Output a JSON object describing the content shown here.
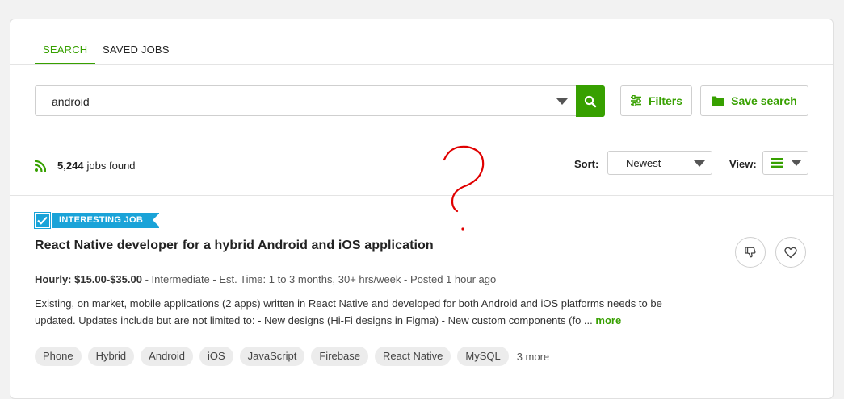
{
  "tabs": [
    {
      "label": "SEARCH",
      "active": true
    },
    {
      "label": "SAVED JOBS",
      "active": false
    }
  ],
  "search": {
    "value": "android",
    "placeholder": ""
  },
  "buttons": {
    "filters": "Filters",
    "save_search": "Save search"
  },
  "results": {
    "count": "5,244",
    "label": "jobs found"
  },
  "sort": {
    "label": "Sort:",
    "value": "Newest"
  },
  "view": {
    "label": "View:"
  },
  "job": {
    "badge": "INTERESTING JOB",
    "title": "React Native developer for a hybrid Android and iOS application",
    "rate": "Hourly: $15.00-$35.00",
    "meta_rest": " - Intermediate - Est. Time: 1 to 3 months, 30+ hrs/week - Posted 1 hour ago",
    "description": "Existing, on market, mobile applications (2 apps) written in React Native and developed for both Android and iOS platforms needs to be updated. Updates include but are not limited to: - New designs (Hi-Fi designs in Figma) - New custom components (fo ...",
    "more": "more",
    "tags": [
      "Phone",
      "Hybrid",
      "Android",
      "iOS",
      "JavaScript",
      "Firebase",
      "React Native",
      "MySQL"
    ],
    "more_tags": "3 more"
  },
  "colors": {
    "accent": "#37a000",
    "badge": "#1aa3d8",
    "annotation": "#e00000"
  },
  "icons": [
    "search-icon",
    "filters-icon",
    "folder-icon",
    "rss-icon",
    "list-view-icon",
    "thumbs-down-icon",
    "heart-icon",
    "check-icon"
  ]
}
